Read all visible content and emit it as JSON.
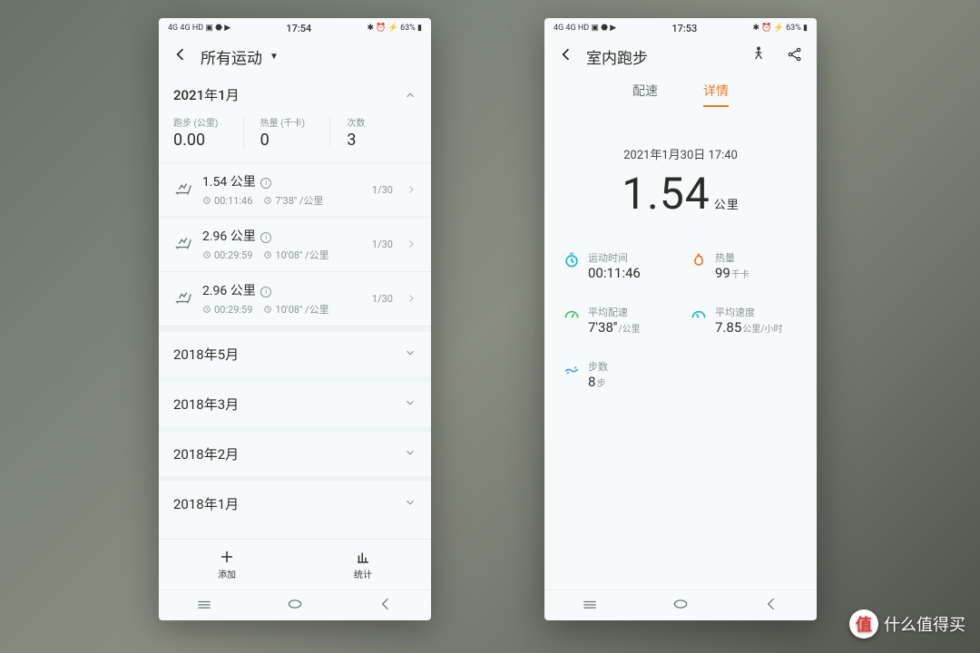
{
  "status": {
    "left_icons": "4G 4G HD ▣ ⬣ ▶",
    "center_left": "17:54",
    "center_right": "17:53",
    "right_icons": "✱ ⏰ ⚡ 63% ▮"
  },
  "left": {
    "header_title": "所有运动",
    "current_month": "2021年1月",
    "stats": {
      "run_label": "跑步 (公里)",
      "run_value": "0.00",
      "cal_label": "热量 (千卡)",
      "cal_value": "0",
      "count_label": "次数",
      "count_value": "3"
    },
    "activities": [
      {
        "dist": "1.54 公里",
        "dur": "00:11:46",
        "pace": "7'38'' /公里",
        "date": "1/30"
      },
      {
        "dist": "2.96 公里",
        "dur": "00:29:59",
        "pace": "10'08'' /公里",
        "date": "1/30"
      },
      {
        "dist": "2.96 公里",
        "dur": "00:29:59",
        "pace": "10'08'' /公里",
        "date": "1/30"
      }
    ],
    "collapsed": [
      "2018年5月",
      "2018年3月",
      "2018年2月",
      "2018年1月"
    ],
    "tabs": {
      "add": "添加",
      "stats": "统计"
    }
  },
  "right": {
    "header_title": "室内跑步",
    "tab_pace": "配速",
    "tab_detail": "详情",
    "datetime": "2021年1月30日 17:40",
    "big_value": "1.54",
    "big_unit": "公里",
    "metrics": {
      "duration_label": "运动时间",
      "duration_value": "00:11:46",
      "cal_label": "热量",
      "cal_value": "99",
      "cal_unit": "千卡",
      "pace_label": "平均配速",
      "pace_value": "7'38''",
      "pace_unit": "/公里",
      "speed_label": "平均速度",
      "speed_value": "7.85",
      "speed_unit": "公里/小时",
      "steps_label": "步数",
      "steps_value": "8",
      "steps_unit": "步"
    }
  },
  "watermark": "什么值得买"
}
